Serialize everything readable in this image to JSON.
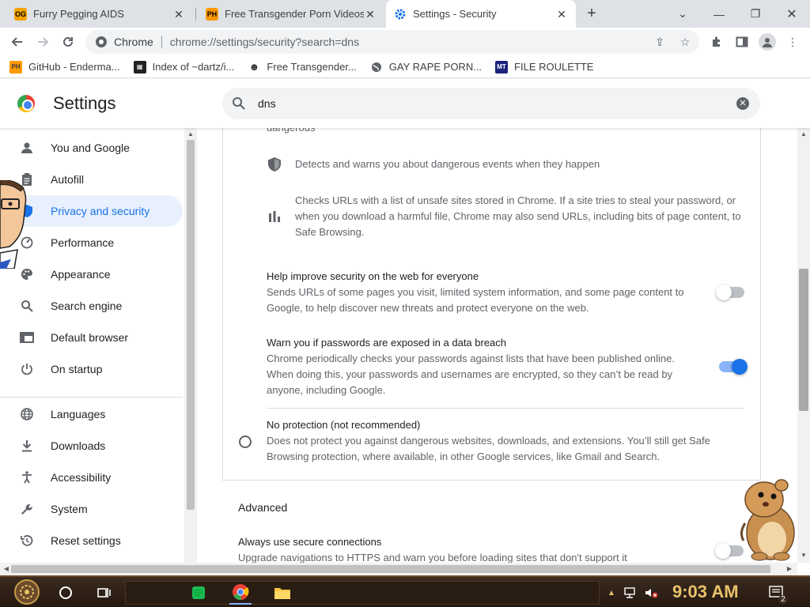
{
  "tabs": [
    {
      "title": "Furry Pegging AIDS",
      "favicon": "OG"
    },
    {
      "title": "Free Transgender Porn Videos",
      "favicon": "PH"
    },
    {
      "title": "Settings - Security",
      "favicon": "gear"
    }
  ],
  "toolbar": {
    "site_label": "Chrome",
    "url": "chrome://settings/security?search=dns"
  },
  "bookmarks": [
    {
      "label": "GitHub - Enderma...",
      "icon": "PH"
    },
    {
      "label": "Index of ~dartz/i...",
      "icon": "film"
    },
    {
      "label": "Free Transgender...",
      "icon": "mask"
    },
    {
      "label": "GAY RAPE PORN...",
      "icon": "globe"
    },
    {
      "label": "FILE ROULETTE",
      "icon": "MT"
    }
  ],
  "settings": {
    "title": "Settings",
    "search_value": "dns"
  },
  "sidebar": {
    "items": [
      {
        "label": "You and Google",
        "icon": "person-icon"
      },
      {
        "label": "Autofill",
        "icon": "clipboard-icon"
      },
      {
        "label": "Privacy and security",
        "icon": "shield-icon",
        "active": true
      },
      {
        "label": "Performance",
        "icon": "speedometer-icon"
      },
      {
        "label": "Appearance",
        "icon": "palette-icon"
      },
      {
        "label": "Search engine",
        "icon": "search-icon"
      },
      {
        "label": "Default browser",
        "icon": "browser-icon"
      },
      {
        "label": "On startup",
        "icon": "power-icon"
      },
      {
        "label": "Languages",
        "icon": "globe-icon"
      },
      {
        "label": "Downloads",
        "icon": "download-icon"
      },
      {
        "label": "Accessibility",
        "icon": "accessibility-icon"
      },
      {
        "label": "System",
        "icon": "wrench-icon"
      },
      {
        "label": "Reset settings",
        "icon": "restore-icon"
      }
    ]
  },
  "content": {
    "cut_text": "dangerous",
    "detect_text": "Detects and warns you about dangerous events when they happen",
    "checks_urls_text_1": "Checks URLs with a list of unsafe sites stored in Chrome. If a site tries to steal your password, or",
    "checks_urls_text_2": "when you download a harmful file, Chrome may also send URLs, including bits of page content, to",
    "checks_urls_text_3": "Safe Browsing.",
    "help_improve_title": "Help improve security on the web for everyone",
    "help_improve_desc_1": "Sends URLs of some pages you visit, limited system information, and some page content to",
    "help_improve_desc_2": "Google, to help discover new threats and protect everyone on the web.",
    "help_improve_enabled": false,
    "warn_pw_title": "Warn you if passwords are exposed in a data breach",
    "warn_pw_desc_1": "Chrome periodically checks your passwords against lists that have been published online.",
    "warn_pw_desc_2": "When doing this, your passwords and usernames are encrypted, so they can’t be read by",
    "warn_pw_desc_3": "anyone, including Google.",
    "warn_pw_enabled": true,
    "no_protection_title": "No protection (not recommended)",
    "no_protection_desc_1": "Does not protect you against dangerous websites, downloads, and extensions. You’ll still get Safe",
    "no_protection_desc_2": "Browsing protection, where available, in other Google services, like Gmail and Search.",
    "advanced_label": "Advanced",
    "secure_conn_title": "Always use secure connections",
    "secure_conn_desc": "Upgrade navigations to HTTPS and warn you before loading sites that don't support it",
    "secure_conn_enabled": false
  },
  "taskbar": {
    "clock": "9:03 AM",
    "notifications": "2"
  },
  "colors": {
    "accent": "#1a73e8",
    "active_bg": "#e8f0fe",
    "tab_strip": "#dee1e6"
  }
}
